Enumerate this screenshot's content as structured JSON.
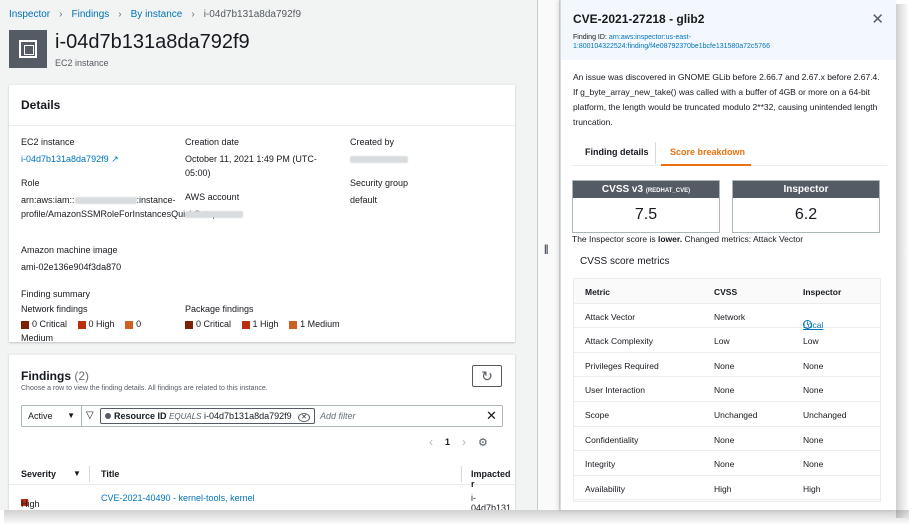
{
  "breadcrumb": [
    "Inspector",
    "Findings",
    "By instance",
    "i-04d7b131a8da792f9"
  ],
  "header": {
    "title": "i-04d7b131a8da792f9",
    "subtitle": "EC2 instance"
  },
  "details": {
    "heading": "Details",
    "ec2_label": "EC2 instance",
    "ec2_value": "i-04d7b131a8da792f9",
    "creation_label": "Creation date",
    "creation_value": "October 11, 2021 1:49 PM (UTC-05:00)",
    "created_by_label": "Created by",
    "role_label": "Role",
    "role_prefix": "arn:aws:iam::",
    "role_suffix": ":instance-profile/AmazonSSMRoleForInstancesQuickSetup",
    "sg_label": "Security group",
    "sg_value": "default",
    "account_label": "AWS account",
    "ami_label": "Amazon machine image",
    "ami_value": "ami-02e136e904f3da870",
    "summary_label": "Finding summary",
    "network_label": "Network findings",
    "package_label": "Package findings",
    "network": [
      "0 Critical",
      "0 High",
      "0 Medium"
    ],
    "package": [
      "0 Critical",
      "1 High",
      "1 Medium"
    ],
    "colors": {
      "critical": "#7d2105",
      "high": "#ba2e0f",
      "medium": "#cc5f21"
    }
  },
  "findings": {
    "title": "Findings",
    "count": "(2)",
    "description": "Choose a row to view the finding details. All findings are related to this instance.",
    "status_select": "Active",
    "token_key": "Resource ID",
    "token_op": "EQUALS",
    "token_value": "i-04d7b131a8da792f9",
    "add_filter_placeholder": "Add filter",
    "page": "1",
    "columns": [
      "Severity",
      "Title",
      "Impacted r"
    ],
    "rows": [
      {
        "severity": "High",
        "title": "CVE-2021-40490 - kernel-tools, kernel",
        "impacted": "i-04d7b131"
      }
    ]
  },
  "panel": {
    "title": "CVE-2021-27218 - glib2",
    "finding_id_label": "Finding ID:",
    "finding_id_value": "arn:aws:inspector:us-east-1:800104322524:finding/f4e08792370be1bcfe131580a72c5766",
    "description": "An issue was discovered in GNOME GLib before 2.66.7 and 2.67.x before 2.67.4. If g_byte_array_new_take() was called with a buffer of 4GB or more on a 64-bit platform, the length would be truncated modulo 2**32, causing unintended length truncation.",
    "tabs": [
      "Finding details",
      "Score breakdown"
    ],
    "cvss_label": "CVSS v3",
    "cvss_source": "(REDHAT_CVE)",
    "cvss_score": "7.5",
    "inspector_label": "Inspector",
    "inspector_score": "6.2",
    "note_prefix": "The Inspector score is",
    "note_bold": "lower.",
    "note_suffix": "Changed metrics: Attack Vector",
    "metrics_heading": "CVSS score metrics",
    "metric_columns": [
      "Metric",
      "CVSS",
      "Inspector"
    ],
    "metrics": [
      {
        "metric": "Attack Vector",
        "cvss": "Network",
        "inspector": "Local"
      },
      {
        "metric": "Attack Complexity",
        "cvss": "Low",
        "inspector": "Low"
      },
      {
        "metric": "Privileges Required",
        "cvss": "None",
        "inspector": "None"
      },
      {
        "metric": "User Interaction",
        "cvss": "None",
        "inspector": "None"
      },
      {
        "metric": "Scope",
        "cvss": "Unchanged",
        "inspector": "Unchanged"
      },
      {
        "metric": "Confidentiality",
        "cvss": "None",
        "inspector": "None"
      },
      {
        "metric": "Integrity",
        "cvss": "None",
        "inspector": "None"
      },
      {
        "metric": "Availability",
        "cvss": "High",
        "inspector": "High"
      }
    ]
  }
}
